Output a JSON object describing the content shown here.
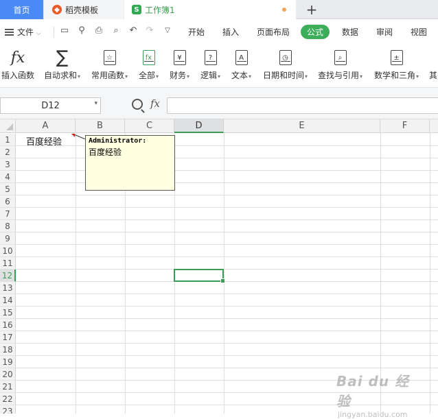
{
  "tabs": [
    {
      "label": "首页"
    },
    {
      "label": "稻壳模板",
      "icon": "docer-logo-icon"
    },
    {
      "label": "工作簿1",
      "icon": "spreadsheet-s-icon"
    }
  ],
  "quick_access": {
    "file_label": "文件"
  },
  "menu": [
    "开始",
    "插入",
    "页面布局",
    "公式",
    "数据",
    "审阅",
    "视图"
  ],
  "menu_active": "公式",
  "ribbon": [
    {
      "label": "插入函数"
    },
    {
      "label": "自动求和"
    },
    {
      "label": "常用函数"
    },
    {
      "label": "全部"
    },
    {
      "label": "财务"
    },
    {
      "label": "逻辑"
    },
    {
      "label": "文本"
    },
    {
      "label": "日期和时间"
    },
    {
      "label": "查找与引用"
    },
    {
      "label": "数学和三角"
    },
    {
      "label": "其"
    }
  ],
  "formula_bar": {
    "name_box": "D12",
    "formula": ""
  },
  "sheet": {
    "columns": [
      "A",
      "B",
      "C",
      "D",
      "E",
      "F"
    ],
    "selected_column": "D",
    "rows": [
      "1",
      "2",
      "3",
      "4",
      "5",
      "6",
      "7",
      "8",
      "9",
      "10",
      "11",
      "12",
      "13",
      "14",
      "15",
      "16",
      "17",
      "18",
      "19",
      "20",
      "21",
      "22",
      "23"
    ],
    "selected_row": "12",
    "cells": {
      "A1": "百度经验"
    },
    "comment": {
      "author": "Administrator:",
      "text": "百度经验"
    }
  },
  "watermark": {
    "main": "Bai du 经验",
    "sub": "jingyan.baidu.com"
  },
  "colors": {
    "accent_green": "#3cae5a",
    "home_tab_blue": "#4a8af4",
    "comment_bg": "#ffffe1"
  }
}
